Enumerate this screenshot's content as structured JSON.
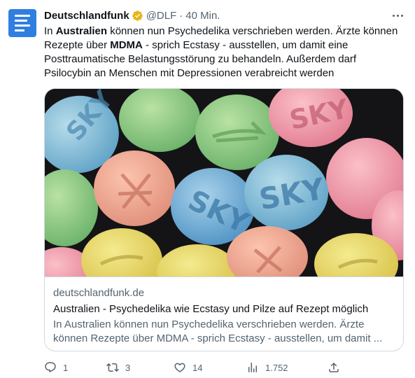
{
  "tweet": {
    "author_name": "Deutschlandfunk",
    "handle": "@DLF",
    "separator": "·",
    "time": "40 Min.",
    "text": {
      "t1": "In ",
      "b1": "Australien",
      "t2": " können nun Psychedelika verschrieben werden. Ärzte können Rezepte über ",
      "b2": "MDMA",
      "t3": " - sprich Ecstasy - ausstellen, um damit eine Posttraumatische Belastungsstörung zu behandeln. Außerdem darf Psilocybin an Menschen mit Depressionen verabreicht werden"
    }
  },
  "card": {
    "image_alt": "Colourful ecstasy pills with SKY and dove stamps",
    "domain": "deutschlandfunk.de",
    "title": "Australien - Psychedelika wie Ecstasy und Pilze auf Rezept möglich",
    "description": "In Australien können nun Psychedelika verschrieben werden. Ärzte können Rezepte über MDMA - sprich Ecstasy - ausstellen, um damit ..."
  },
  "actions": {
    "replies": "1",
    "retweets": "3",
    "likes": "14",
    "views": "1.752"
  },
  "pill_stamps": [
    "SKY",
    "SKY",
    "SKY",
    "SKY"
  ],
  "icons": [
    "avatar-logo-icon",
    "verified-badge-icon",
    "more-icon",
    "reply-icon",
    "retweet-icon",
    "like-icon",
    "views-icon",
    "share-icon"
  ],
  "colors": {
    "accent": "#1d9bf0",
    "verified_gold": "#e2b719",
    "avatar_blue": "#2f7fe0",
    "text_primary": "#0f1419",
    "text_secondary": "#536471",
    "border": "#cfd9de"
  }
}
